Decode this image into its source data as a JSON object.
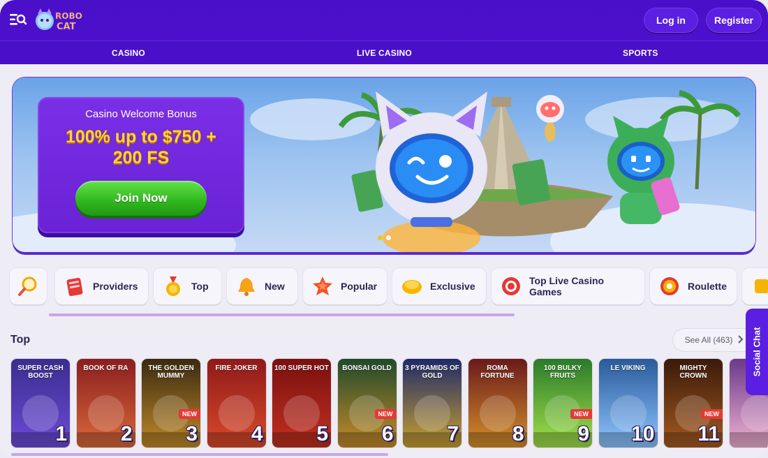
{
  "header": {
    "logo_text": "ROBO CAT",
    "login_label": "Log in",
    "register_label": "Register"
  },
  "nav": {
    "items": [
      {
        "label": "CASINO"
      },
      {
        "label": "LIVE CASINO"
      },
      {
        "label": "SPORTS"
      }
    ]
  },
  "banner": {
    "promo_subtitle": "Casino Welcome Bonus",
    "promo_line1": "100% up to $750 +",
    "promo_line2": "200 FS",
    "cta_label": "Join Now",
    "slides": 2,
    "active_slide": 1
  },
  "categories": [
    {
      "label": "",
      "icon": "search-icon"
    },
    {
      "label": "Providers",
      "icon": "providers-icon"
    },
    {
      "label": "Top",
      "icon": "medal-icon"
    },
    {
      "label": "New",
      "icon": "bell-icon"
    },
    {
      "label": "Popular",
      "icon": "star-icon"
    },
    {
      "label": "Exclusive",
      "icon": "gem-icon"
    },
    {
      "label": "Top Live Casino Games",
      "icon": "chips-icon"
    },
    {
      "label": "Roulette",
      "icon": "roulette-icon"
    }
  ],
  "top_section": {
    "title": "Top",
    "see_all_label": "See All (463)",
    "games": [
      {
        "title": "SUPER CASH BOOST",
        "rank": "1",
        "new": false
      },
      {
        "title": "BOOK OF RA",
        "rank": "2",
        "new": false
      },
      {
        "title": "THE GOLDEN MUMMY",
        "rank": "3",
        "new": true
      },
      {
        "title": "FIRE JOKER",
        "rank": "4",
        "new": false
      },
      {
        "title": "100 SUPER HOT",
        "rank": "5",
        "new": false
      },
      {
        "title": "BONSAI GOLD",
        "rank": "6",
        "new": true
      },
      {
        "title": "3 PYRAMIDS OF GOLD",
        "rank": "7",
        "new": false
      },
      {
        "title": "ROMA FORTUNE",
        "rank": "8",
        "new": false
      },
      {
        "title": "100 BULKY FRUITS",
        "rank": "9",
        "new": true
      },
      {
        "title": "LE VIKING",
        "rank": "10",
        "new": false
      },
      {
        "title": "MIGHTY CROWN",
        "rank": "11",
        "new": true
      },
      {
        "title": "",
        "rank": "",
        "new": false
      }
    ],
    "new_badge": "NEW"
  },
  "social_chat": {
    "label": "Social Chat"
  },
  "colors": {
    "brand": "#4a0fc9",
    "accent_yellow": "#ffd43b",
    "cta_green": "#2fb61d",
    "scroll_indicator": "#c9a6ea"
  }
}
